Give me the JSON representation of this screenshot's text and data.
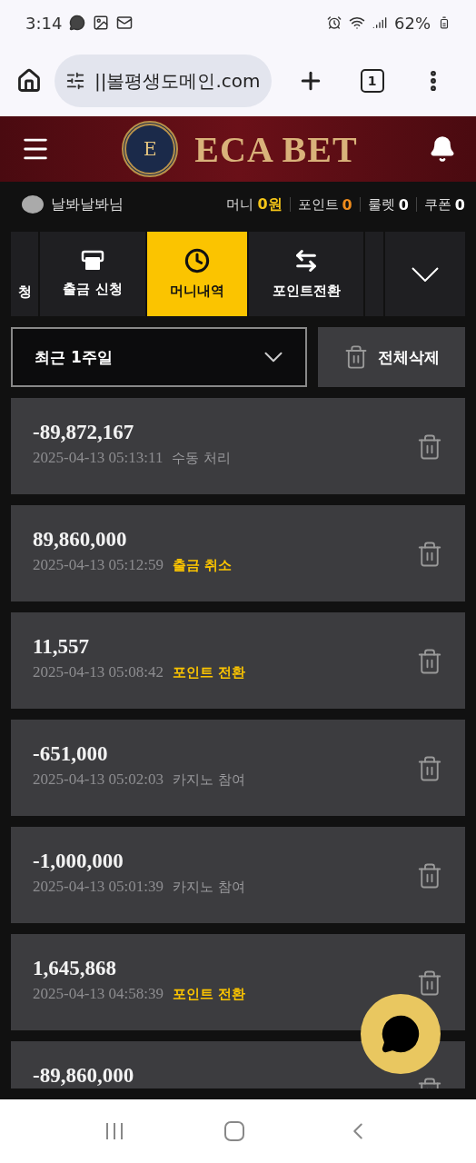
{
  "status_bar": {
    "time": "3:14",
    "battery": "62%"
  },
  "browser": {
    "url": "||볼평생도메인.com",
    "tab_count": "1"
  },
  "header": {
    "emblem_letter": "E",
    "title": "ECA BET"
  },
  "user": {
    "name": "날봐날봐님",
    "balances": [
      {
        "label": "머니",
        "value": "0원",
        "color": "#f5c518"
      },
      {
        "label": "포인트",
        "value": "0",
        "color": "#f08c1c"
      },
      {
        "label": "룰렛",
        "value": "0",
        "color": "#ffffff"
      },
      {
        "label": "쿠폰",
        "value": "0",
        "color": "#ffffff"
      }
    ]
  },
  "tabs": [
    {
      "kind": "cut",
      "label": "청",
      "selected": false
    },
    {
      "kind": "atm",
      "label": "출금 신청",
      "selected": false
    },
    {
      "kind": "clock",
      "label": "머니내역",
      "selected": true
    },
    {
      "kind": "transfer",
      "label": "포인트전환",
      "selected": false
    },
    {
      "kind": "blank",
      "selected": false
    }
  ],
  "filter": {
    "value": "최근 1주일",
    "delete_all": "전체삭제"
  },
  "entries": [
    {
      "amount": "-89,872,167",
      "time": "2025-04-13 05:13:11",
      "type": "수동 처리",
      "highlight": false
    },
    {
      "amount": "89,860,000",
      "time": "2025-04-13 05:12:59",
      "type": "출금 취소",
      "highlight": true
    },
    {
      "amount": "11,557",
      "time": "2025-04-13 05:08:42",
      "type": "포인트 전환",
      "highlight": true
    },
    {
      "amount": "-651,000",
      "time": "2025-04-13 05:02:03",
      "type": "카지노 참여",
      "highlight": false
    },
    {
      "amount": "-1,000,000",
      "time": "2025-04-13 05:01:39",
      "type": "카지노 참여",
      "highlight": false
    },
    {
      "amount": "1,645,868",
      "time": "2025-04-13 04:58:39",
      "type": "포인트 전환",
      "highlight": true
    },
    {
      "amount": "-89,860,000"
    }
  ]
}
